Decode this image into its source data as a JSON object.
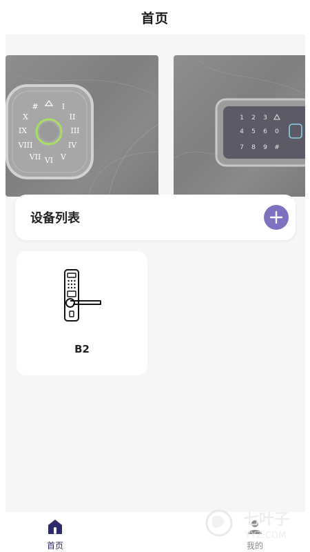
{
  "header": {
    "title": "首页"
  },
  "banner": {
    "slide1": {
      "keys": [
        "#",
        "I",
        "II",
        "III",
        "IV",
        "V",
        "VI",
        "VII",
        "VIII",
        "IX",
        "X"
      ],
      "ring_color": "#a8e063"
    },
    "slide2": {
      "keys": [
        "1",
        "2",
        "3",
        "4",
        "5",
        "6",
        "0",
        "7",
        "8",
        "9",
        "#"
      ]
    }
  },
  "device_list": {
    "title": "设备列表",
    "add_icon": "plus-icon",
    "accent_color": "#7d72bf"
  },
  "devices": [
    {
      "name": "B2",
      "icon": "door-lock-icon"
    }
  ],
  "tabbar": {
    "items": [
      {
        "label": "首页",
        "icon": "home-icon",
        "active": true
      },
      {
        "label": "我的",
        "icon": "user-icon",
        "active": false
      }
    ],
    "active_color": "#2d2a6b",
    "inactive_color": "#8a8a8a"
  },
  "watermark": {
    "text": "七叶子",
    "subtext": "YYZ.COM"
  }
}
